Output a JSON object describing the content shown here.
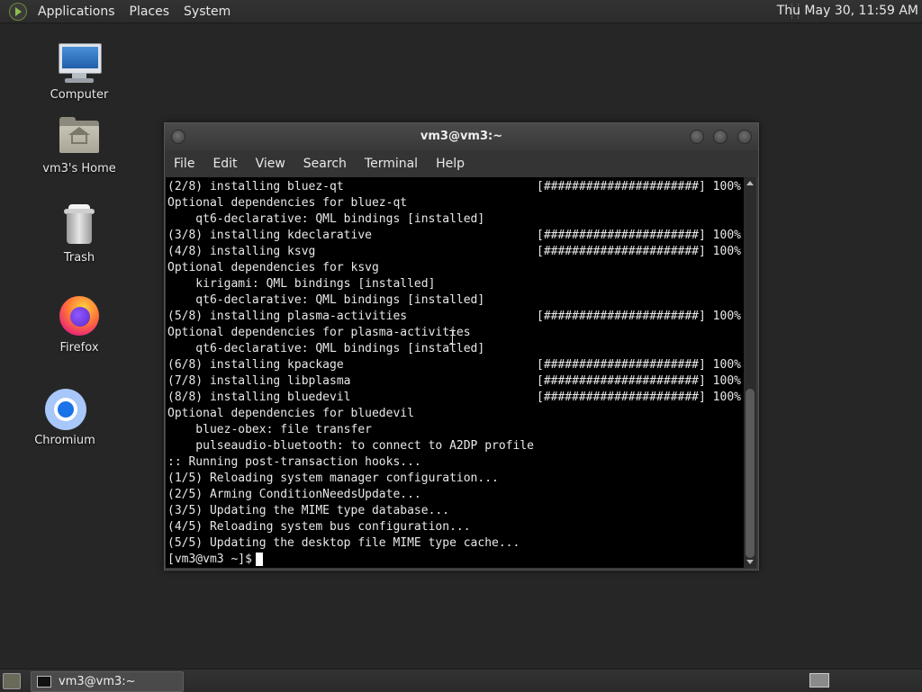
{
  "top_panel": {
    "menus": [
      "Applications",
      "Places",
      "System"
    ],
    "clock": "Thu May 30, 11:59 AM"
  },
  "desktop_icons": [
    {
      "label": "Computer",
      "icon": "computer-icon"
    },
    {
      "label": "vm3's Home",
      "icon": "home-folder-icon"
    },
    {
      "label": "Trash",
      "icon": "trash-icon"
    },
    {
      "label": "Firefox",
      "icon": "firefox-icon"
    },
    {
      "label": "Chromium",
      "icon": "chromium-icon"
    }
  ],
  "terminal": {
    "title": "vm3@vm3:~",
    "menu": [
      "File",
      "Edit",
      "View",
      "Search",
      "Terminal",
      "Help"
    ],
    "lines": [
      {
        "text": "(2/8) installing bluez-qt",
        "right": "[######################] 100%"
      },
      {
        "text": "Optional dependencies for bluez-qt",
        "right": ""
      },
      {
        "text": "    qt6-declarative: QML bindings [installed]",
        "right": ""
      },
      {
        "text": "(3/8) installing kdeclarative",
        "right": "[######################] 100%"
      },
      {
        "text": "(4/8) installing ksvg",
        "right": "[######################] 100%"
      },
      {
        "text": "Optional dependencies for ksvg",
        "right": ""
      },
      {
        "text": "    kirigami: QML bindings [installed]",
        "right": ""
      },
      {
        "text": "    qt6-declarative: QML bindings [installed]",
        "right": ""
      },
      {
        "text": "(5/8) installing plasma-activities",
        "right": "[######################] 100%"
      },
      {
        "text": "Optional dependencies for plasma-activities",
        "right": ""
      },
      {
        "text": "    qt6-declarative: QML bindings [installed]",
        "right": ""
      },
      {
        "text": "(6/8) installing kpackage",
        "right": "[######################] 100%"
      },
      {
        "text": "(7/8) installing libplasma",
        "right": "[######################] 100%"
      },
      {
        "text": "(8/8) installing bluedevil",
        "right": "[######################] 100%"
      },
      {
        "text": "Optional dependencies for bluedevil",
        "right": ""
      },
      {
        "text": "    bluez-obex: file transfer",
        "right": ""
      },
      {
        "text": "    pulseaudio-bluetooth: to connect to A2DP profile",
        "right": ""
      },
      {
        "text": ":: Running post-transaction hooks...",
        "right": ""
      },
      {
        "text": "(1/5) Reloading system manager configuration...",
        "right": ""
      },
      {
        "text": "(2/5) Arming ConditionNeedsUpdate...",
        "right": ""
      },
      {
        "text": "(3/5) Updating the MIME type database...",
        "right": ""
      },
      {
        "text": "(4/5) Reloading system bus configuration...",
        "right": ""
      },
      {
        "text": "(5/5) Updating the desktop file MIME type cache...",
        "right": ""
      }
    ],
    "prompt": "[vm3@vm3 ~]$"
  },
  "bottom_panel": {
    "task_label": "vm3@vm3:~"
  }
}
